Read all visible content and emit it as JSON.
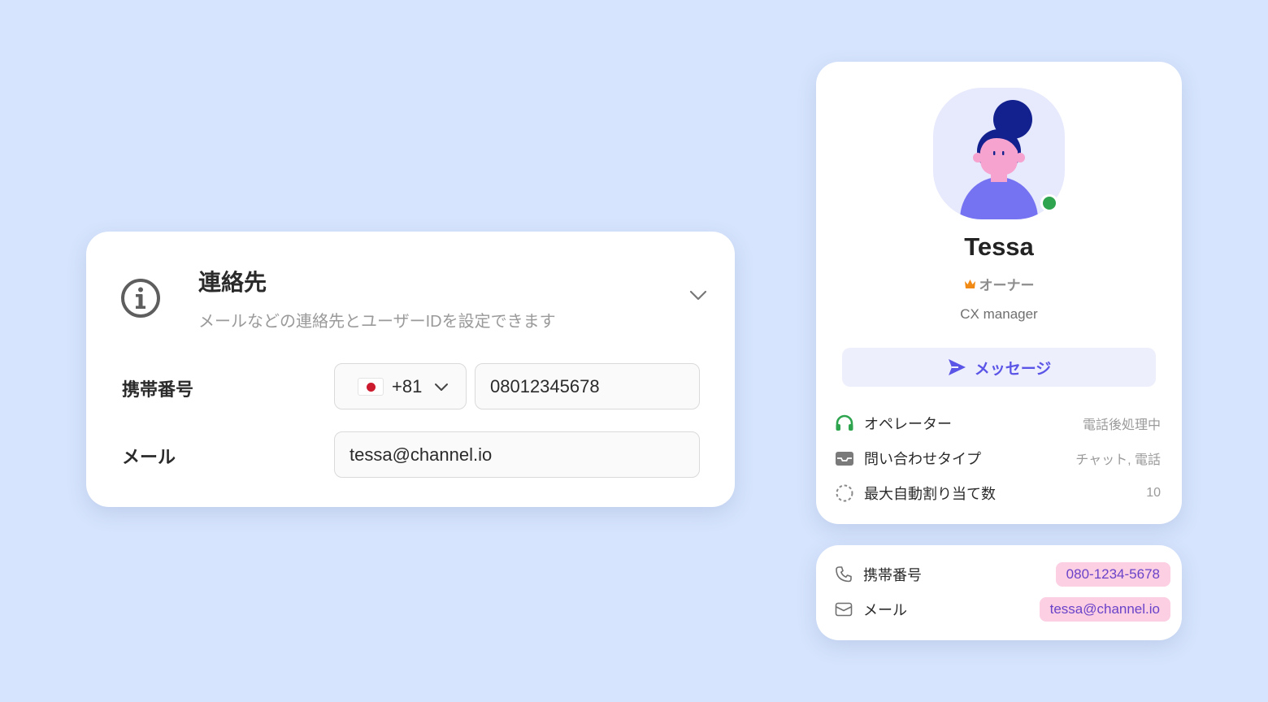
{
  "contact_settings": {
    "title": "連絡先",
    "description": "メールなどの連絡先とユーザーIDを設定できます",
    "phone_label": "携帯番号",
    "country_code": "+81",
    "country_flag_icon": "japan-flag-icon",
    "phone_value": "08012345678",
    "email_label": "メール",
    "email_value": "tessa@channel.io"
  },
  "profile": {
    "name": "Tessa",
    "role": "オーナー",
    "job_title": "CX manager",
    "status_color": "#2ea44f",
    "message_button_label": "メッセージ",
    "info_rows": [
      {
        "icon": "headset-icon",
        "label": "オペレーター",
        "value": "電話後処理中"
      },
      {
        "icon": "inbox-icon",
        "label": "問い合わせタイプ",
        "value": "チャット, 電話"
      },
      {
        "icon": "dashed-circle-icon",
        "label": "最大自動割り当て数",
        "value": "10"
      }
    ]
  },
  "contact_mini": {
    "phone_label": "携帯番号",
    "phone_value": "080-1234-5678",
    "email_label": "メール",
    "email_value": "tessa@channel.io"
  }
}
